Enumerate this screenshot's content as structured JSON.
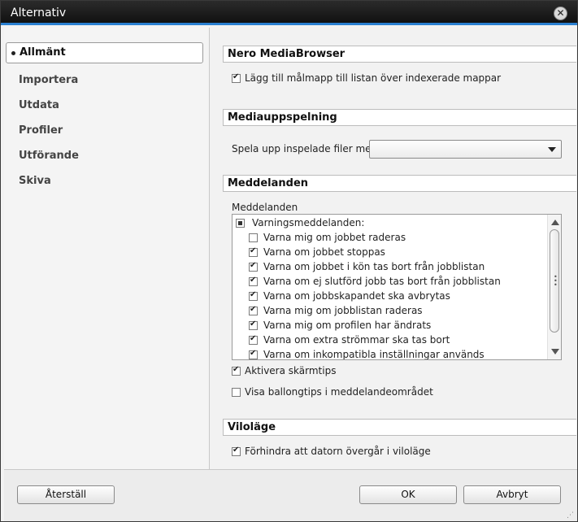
{
  "window": {
    "title": "Alternativ"
  },
  "sidebar": {
    "items": [
      {
        "label": "Allmänt"
      },
      {
        "label": "Importera"
      },
      {
        "label": "Utdata"
      },
      {
        "label": "Profiler"
      },
      {
        "label": "Utförande"
      },
      {
        "label": "Skiva"
      }
    ]
  },
  "sections": {
    "media_browser": {
      "title": "Nero MediaBrowser",
      "option_label": "Lägg till målmapp till listan över indexerade mappar",
      "option_checked": true
    },
    "playback": {
      "title": "Mediauppspelning",
      "field_label": "Spela upp inspelade filer med:",
      "select_value": ""
    },
    "notifications": {
      "title": "Meddelanden",
      "list_label": "Meddelanden",
      "group_label": "Varningsmeddelanden:",
      "items": [
        {
          "label": "Varna mig om jobbet raderas",
          "checked": false
        },
        {
          "label": "Varna om jobbet stoppas",
          "checked": true
        },
        {
          "label": "Varna om jobbet i kön tas bort från jobblistan",
          "checked": true
        },
        {
          "label": "Varna om ej slutförd jobb tas bort från jobblistan",
          "checked": true
        },
        {
          "label": "Varna om jobbskapandet ska avbrytas",
          "checked": true
        },
        {
          "label": "Varna mig om jobblistan raderas",
          "checked": true
        },
        {
          "label": "Varna mig om profilen har ändrats",
          "checked": true
        },
        {
          "label": "Varna om extra strömmar ska tas bort",
          "checked": true
        },
        {
          "label": "Varna om inkompatibla inställningar används",
          "checked": true
        }
      ],
      "screen_tips_label": "Aktivera skärmtips",
      "screen_tips_checked": true,
      "balloon_tips_label": "Visa ballongtips i meddelandeområdet",
      "balloon_tips_checked": false
    },
    "sleep": {
      "title": "Viloläge",
      "option_label": "Förhindra att datorn övergår i viloläge",
      "option_checked": true
    }
  },
  "footer": {
    "reset_label": "Återställ",
    "ok_label": "OK",
    "cancel_label": "Avbryt"
  },
  "colors": {
    "accent": "#2a7fd0",
    "titlebar": "#1a1a1a"
  }
}
